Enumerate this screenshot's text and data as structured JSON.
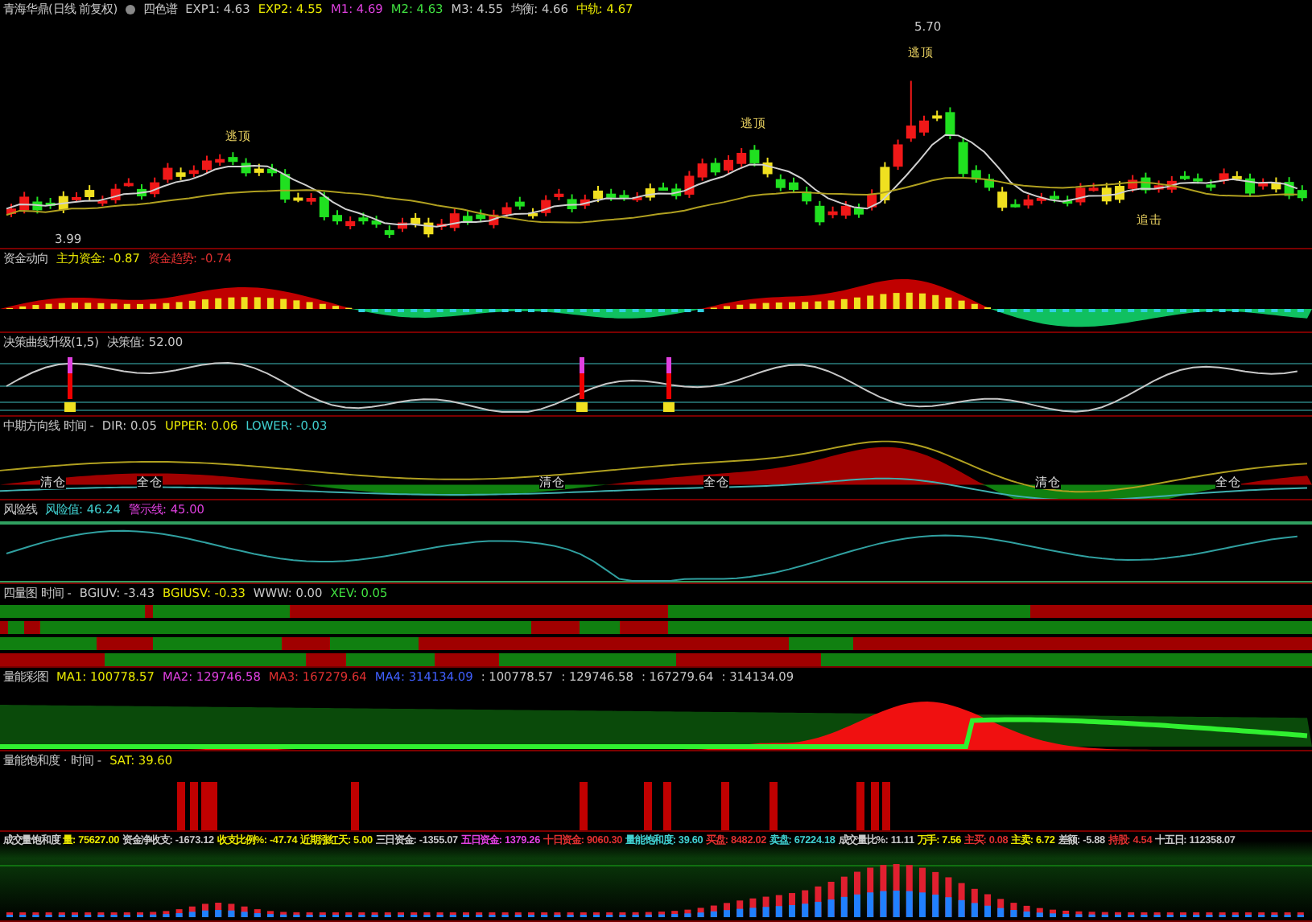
{
  "main_chart": {
    "header": [
      {
        "text": "青海华鼎(日线 前复权)",
        "color": "#c8c8c8"
      },
      {
        "text": "四色谱",
        "color": "#c8c8c8"
      },
      {
        "text": "EXP1: 4.63",
        "color": "#c8c8c8"
      },
      {
        "text": "EXP2: 4.55",
        "color": "#e8e800"
      },
      {
        "text": "M1: 4.69",
        "color": "#e040e0"
      },
      {
        "text": "M2: 4.63",
        "color": "#40e040"
      },
      {
        "text": "M3: 4.55",
        "color": "#c8c8c8"
      },
      {
        "text": "均衡: 4.66",
        "color": "#c8c8c8"
      },
      {
        "text": "中轨: 4.67",
        "color": "#e8e800"
      }
    ],
    "labels": [
      "逃顶",
      "逃顶",
      "逃顶",
      "追击"
    ],
    "high_price": "5.70",
    "low_price": "3.99"
  },
  "panels": [
    {
      "kind": "fund",
      "header": [
        {
          "text": "资金动向",
          "color": "#c8c8c8"
        },
        {
          "text": "主力资金: -0.87",
          "color": "#e8e800"
        },
        {
          "text": "资金趋势: -0.74",
          "color": "#e03030"
        }
      ]
    },
    {
      "kind": "decision",
      "header": [
        {
          "text": "决策曲线升级(1,5)",
          "color": "#c8c8c8"
        },
        {
          "text": "决策值: 52.00",
          "color": "#c8c8c8"
        }
      ]
    },
    {
      "kind": "direction",
      "header": [
        {
          "text": "中期方向线 时间 -",
          "color": "#c8c8c8"
        },
        {
          "text": "DIR: 0.05",
          "color": "#c8c8c8"
        },
        {
          "text": "UPPER: 0.06",
          "color": "#e8e800"
        },
        {
          "text": "LOWER: -0.03",
          "color": "#40d0d0"
        }
      ],
      "labels": [
        "清仓",
        "全仓",
        "清仓",
        "全仓",
        "清仓",
        "全仓"
      ]
    },
    {
      "kind": "risk",
      "header": [
        {
          "text": "风险线",
          "color": "#c8c8c8"
        },
        {
          "text": "风险值: 46.24",
          "color": "#40d0d0"
        },
        {
          "text": "警示线: 45.00",
          "color": "#e040e0"
        }
      ]
    },
    {
      "kind": "quad",
      "header": [
        {
          "text": "四量图 时间 -",
          "color": "#c8c8c8"
        },
        {
          "text": "BGIUV: -3.43",
          "color": "#c8c8c8"
        },
        {
          "text": "BGIUSV: -0.33",
          "color": "#e8e800"
        },
        {
          "text": "WWW: 0.00",
          "color": "#c8c8c8"
        },
        {
          "text": "XEV: 0.05",
          "color": "#40e040"
        }
      ]
    },
    {
      "kind": "volume_color",
      "header": [
        {
          "text": "量能彩图",
          "color": "#c8c8c8"
        },
        {
          "text": "MA1: 100778.57",
          "color": "#e8e800"
        },
        {
          "text": "MA2: 129746.58",
          "color": "#e040e0"
        },
        {
          "text": "MA3: 167279.64",
          "color": "#e03030"
        },
        {
          "text": "MA4: 314134.09",
          "color": "#4060ff"
        },
        {
          "text": ": 100778.57",
          "color": "#c8c8c8"
        },
        {
          "text": ": 129746.58",
          "color": "#c8c8c8"
        },
        {
          "text": ": 167279.64",
          "color": "#c8c8c8"
        },
        {
          "text": ": 314134.09",
          "color": "#c8c8c8"
        }
      ]
    },
    {
      "kind": "saturation",
      "header": [
        {
          "text": "量能饱和度 · 时间 -",
          "color": "#c8c8c8"
        },
        {
          "text": "SAT: 39.60",
          "color": "#e8e800"
        }
      ]
    },
    {
      "kind": "turnover",
      "header": [
        {
          "text": "成交量饱和度",
          "color": "#c8c8c8"
        },
        {
          "text": "量: 75627.00",
          "color": "#e8e800"
        },
        {
          "text": "资金净收支: -1673.12",
          "color": "#c8c8c8"
        },
        {
          "text": "收支比例%: -47.74",
          "color": "#e8e800"
        },
        {
          "text": "近期涨红天: 5.00",
          "color": "#e8e800"
        },
        {
          "text": "三日资金: -1355.07",
          "color": "#c8c8c8"
        },
        {
          "text": "五日资金: 1379.26",
          "color": "#e040e0"
        },
        {
          "text": "十日资金: 9060.30",
          "color": "#e03030"
        },
        {
          "text": "量能饱和度: 39.60",
          "color": "#40d0d0"
        },
        {
          "text": "买盘: 8482.02",
          "color": "#e03030"
        },
        {
          "text": "卖盘: 67224.18",
          "color": "#40d0d0"
        },
        {
          "text": "成交量比%: 11.11",
          "color": "#c8c8c8"
        },
        {
          "text": "万手: 7.56",
          "color": "#e8e800"
        },
        {
          "text": "主买: 0.08",
          "color": "#e03030"
        },
        {
          "text": "主卖: 6.72",
          "color": "#e8e800"
        },
        {
          "text": "差额: -5.88",
          "color": "#c8c8c8"
        },
        {
          "text": "持股: 4.54",
          "color": "#e03030"
        },
        {
          "text": "十五日: 112358.07",
          "color": "#c8c8c8"
        }
      ]
    }
  ]
}
